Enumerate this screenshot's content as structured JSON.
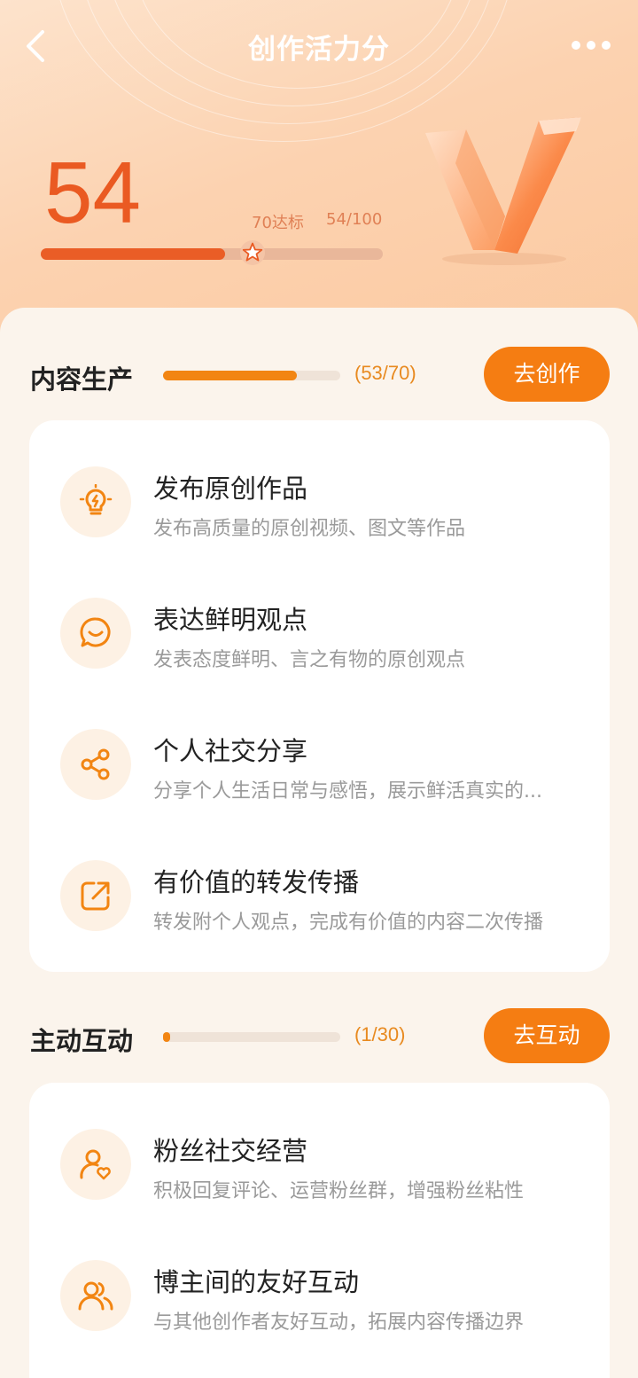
{
  "header": {
    "title": "创作活力分",
    "back_icon": "back-chevron-icon",
    "more_icon": "more-dots-icon"
  },
  "score": {
    "value": "54",
    "target_label": "70达标",
    "progress_text": "54/100",
    "progress_fraction": 0.54,
    "target_fraction": 0.7
  },
  "colors": {
    "accent": "#f57d12",
    "score": "#ea5a22",
    "card_bg": "#ffffff"
  },
  "sections": [
    {
      "title": "内容生产",
      "count": "(53/70)",
      "progress_fraction": 0.757,
      "button": "去创作",
      "items": [
        {
          "icon": "lightbulb-icon",
          "name": "发布原创作品",
          "desc": "发布高质量的原创视频、图文等作品"
        },
        {
          "icon": "chat-smile-icon",
          "name": "表达鲜明观点",
          "desc": "发表态度鲜明、言之有物的原创观点"
        },
        {
          "icon": "share-icon",
          "name": "个人社交分享",
          "desc": "分享个人生活日常与感悟，展示鲜活真实的..."
        },
        {
          "icon": "forward-icon",
          "name": "有价值的转发传播",
          "desc": "转发附个人观点，完成有价值的内容二次传播"
        }
      ]
    },
    {
      "title": "主动互动",
      "count": "(1/30)",
      "progress_fraction": 0.033,
      "button": "去互动",
      "items": [
        {
          "icon": "user-heart-icon",
          "name": "粉丝社交经营",
          "desc": "积极回复评论、运营粉丝群，增强粉丝粘性"
        },
        {
          "icon": "users-icon",
          "name": "博主间的友好互动",
          "desc": "与其他创作者友好互动，拓展内容传播边界"
        }
      ]
    }
  ]
}
